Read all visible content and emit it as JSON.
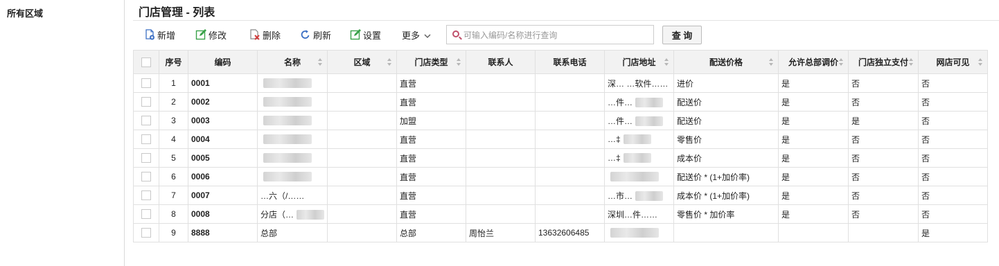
{
  "sidebar": {
    "title": "所有区域"
  },
  "page": {
    "title": "门店管理 - 列表"
  },
  "toolbar": {
    "add": "新增",
    "edit": "修改",
    "delete": "删除",
    "refresh": "刷新",
    "settings": "设置",
    "more": "更多",
    "search_placeholder": "可输入编码/名称进行查询",
    "query": "查 询"
  },
  "colors": {
    "code_link": "#2a73b7",
    "add_icon": "#3b6fc4",
    "edit_icon": "#3aa24a",
    "delete_icon": "#d23a3a",
    "search_icon": "#c0506b"
  },
  "table": {
    "columns": [
      "序号",
      "编码",
      "名称",
      "区域",
      "门店类型",
      "联系人",
      "联系电话",
      "门店地址",
      "配送价格",
      "允许总部调价",
      "门店独立支付",
      "网店可见"
    ],
    "rows": [
      {
        "seq": "1",
        "code": "0001",
        "name": "",
        "region": "",
        "type": "直营",
        "contact": "",
        "phone": "",
        "address": "深…  …软件…",
        "price": "进价",
        "hq_adjust": "是",
        "indep_pay": "否",
        "online": "否"
      },
      {
        "seq": "2",
        "code": "0002",
        "name": "",
        "region": "",
        "type": "直营",
        "contact": "",
        "phone": "",
        "address": "…件…",
        "price": "配送价",
        "hq_adjust": "是",
        "indep_pay": "否",
        "online": "否"
      },
      {
        "seq": "3",
        "code": "0003",
        "name": "",
        "region": "",
        "type": "加盟",
        "contact": "",
        "phone": "",
        "address": "…件…",
        "price": "配送价",
        "hq_adjust": "是",
        "indep_pay": "是",
        "online": "否"
      },
      {
        "seq": "4",
        "code": "0004",
        "name": "",
        "region": "",
        "type": "直营",
        "contact": "",
        "phone": "",
        "address": "…‡",
        "price": "零售价",
        "hq_adjust": "是",
        "indep_pay": "否",
        "online": "否"
      },
      {
        "seq": "5",
        "code": "0005",
        "name": "",
        "region": "",
        "type": "直营",
        "contact": "",
        "phone": "",
        "address": "…‡",
        "price": "成本价",
        "hq_adjust": "是",
        "indep_pay": "否",
        "online": "否"
      },
      {
        "seq": "6",
        "code": "0006",
        "name": "",
        "region": "",
        "type": "直营",
        "contact": "",
        "phone": "",
        "address": "",
        "price": "配送价 * (1+加价率)",
        "hq_adjust": "是",
        "indep_pay": "否",
        "online": "否"
      },
      {
        "seq": "7",
        "code": "0007",
        "name": "…六（/…",
        "region": "",
        "type": "直营",
        "contact": "",
        "phone": "",
        "address": "…市…",
        "price": "成本价 * (1+加价率)",
        "hq_adjust": "是",
        "indep_pay": "否",
        "online": "否"
      },
      {
        "seq": "8",
        "code": "0008",
        "name": "分店（…",
        "region": "",
        "type": "直营",
        "contact": "",
        "phone": "",
        "address": "深圳…件…",
        "price": "零售价 * 加价率",
        "hq_adjust": "是",
        "indep_pay": "否",
        "online": "否"
      },
      {
        "seq": "9",
        "code": "8888",
        "name": "总部",
        "region": "",
        "type": "总部",
        "contact": "周怡兰",
        "phone": "13632606485",
        "address": "",
        "price": "",
        "hq_adjust": "",
        "indep_pay": "",
        "online": "是"
      }
    ]
  }
}
